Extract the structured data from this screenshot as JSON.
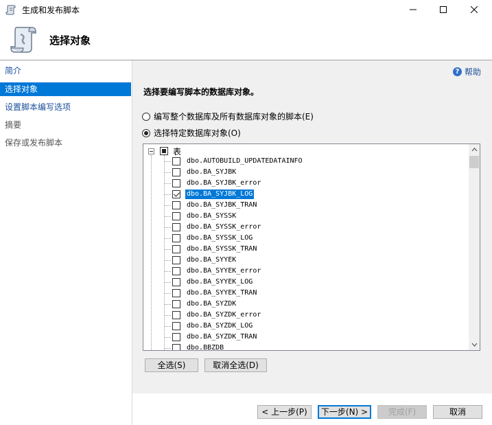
{
  "window": {
    "title": "生成和发布脚本",
    "minimize_icon": "minimize-icon",
    "maximize_icon": "maximize-icon",
    "close_icon": "close-icon"
  },
  "header": {
    "title": "选择对象",
    "icon": "script-scroll-icon"
  },
  "sidebar": {
    "items": [
      {
        "label": "简介",
        "state": "link"
      },
      {
        "label": "选择对象",
        "state": "active"
      },
      {
        "label": "设置脚本编写选项",
        "state": "link"
      },
      {
        "label": "摘要",
        "state": "disabled"
      },
      {
        "label": "保存或发布脚本",
        "state": "disabled"
      }
    ]
  },
  "main": {
    "help_label": "帮助",
    "section_title": "选择要编写脚本的数据库对象。",
    "radio_all": {
      "label": "编写整个数据库及所有数据库对象的脚本(E)",
      "checked": false
    },
    "radio_specific": {
      "label": "选择特定数据库对象(O)",
      "checked": true
    },
    "tree": {
      "root_label": "表",
      "items": [
        {
          "label": "dbo.AUTOBUILD_UPDATEDATAINFO",
          "checked": false,
          "selected": false
        },
        {
          "label": "dbo.BA_SYJBK",
          "checked": false,
          "selected": false
        },
        {
          "label": "dbo.BA_SYJBK_error",
          "checked": false,
          "selected": false
        },
        {
          "label": "dbo.BA_SYJBK_LOG",
          "checked": true,
          "selected": true
        },
        {
          "label": "dbo.BA_SYJBK_TRAN",
          "checked": false,
          "selected": false
        },
        {
          "label": "dbo.BA_SYSSK",
          "checked": false,
          "selected": false
        },
        {
          "label": "dbo.BA_SYSSK_error",
          "checked": false,
          "selected": false
        },
        {
          "label": "dbo.BA_SYSSK_LOG",
          "checked": false,
          "selected": false
        },
        {
          "label": "dbo.BA_SYSSK_TRAN",
          "checked": false,
          "selected": false
        },
        {
          "label": "dbo.BA_SYYEK",
          "checked": false,
          "selected": false
        },
        {
          "label": "dbo.BA_SYYEK_error",
          "checked": false,
          "selected": false
        },
        {
          "label": "dbo.BA_SYYEK_LOG",
          "checked": false,
          "selected": false
        },
        {
          "label": "dbo.BA_SYYEK_TRAN",
          "checked": false,
          "selected": false
        },
        {
          "label": "dbo.BA_SYZDK",
          "checked": false,
          "selected": false
        },
        {
          "label": "dbo.BA_SYZDK_error",
          "checked": false,
          "selected": false
        },
        {
          "label": "dbo.BA_SYZDK_LOG",
          "checked": false,
          "selected": false
        },
        {
          "label": "dbo.BA_SYZDK_TRAN",
          "checked": false,
          "selected": false
        },
        {
          "label": "dbo.BBZDB",
          "checked": false,
          "selected": false
        }
      ]
    },
    "select_all_label": "全选(S)",
    "deselect_all_label": "取消全选(D)"
  },
  "footer": {
    "prev_label": "< 上一步(P)",
    "next_label": "下一步(N) >",
    "finish_label": "完成(F)",
    "cancel_label": "取消"
  },
  "colors": {
    "accent": "#0078d7",
    "link": "#1a4f9c",
    "panel_bg": "#f0f0f0"
  }
}
